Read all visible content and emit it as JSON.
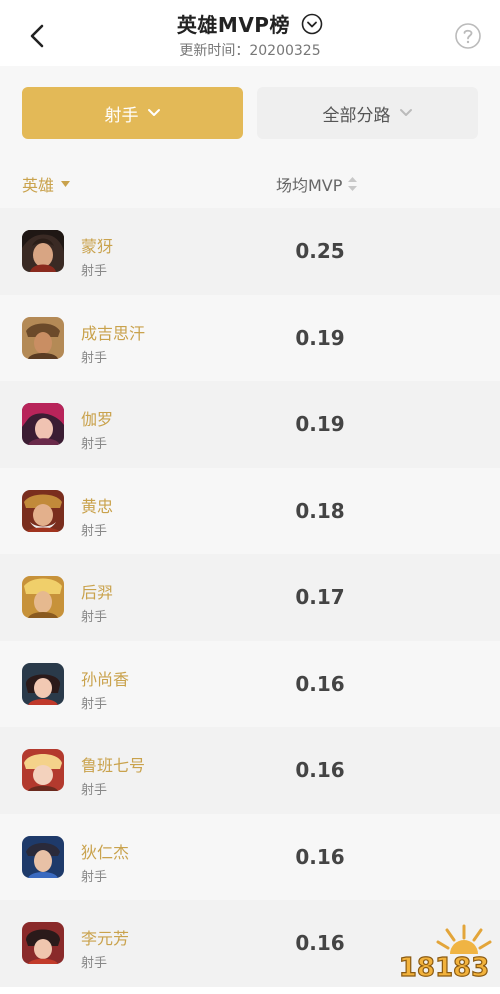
{
  "header": {
    "title": "英雄MVP榜",
    "update_label": "更新时间：20200325",
    "back_icon": "chevron-left-icon",
    "toggle_icon": "chevron-down-circle-icon",
    "help_icon": "question-circle-icon"
  },
  "filters": {
    "role_label": "射手",
    "lane_label": "全部分路"
  },
  "columns": {
    "hero": "英雄",
    "mvp": "场均MVP"
  },
  "heroes": [
    {
      "name": "蒙犽",
      "role": "射手",
      "mvp": "0.25"
    },
    {
      "name": "成吉思汗",
      "role": "射手",
      "mvp": "0.19"
    },
    {
      "name": "伽罗",
      "role": "射手",
      "mvp": "0.19"
    },
    {
      "name": "黄忠",
      "role": "射手",
      "mvp": "0.18"
    },
    {
      "name": "后羿",
      "role": "射手",
      "mvp": "0.17"
    },
    {
      "name": "孙尚香",
      "role": "射手",
      "mvp": "0.16"
    },
    {
      "name": "鲁班七号",
      "role": "射手",
      "mvp": "0.16"
    },
    {
      "name": "狄仁杰",
      "role": "射手",
      "mvp": "0.16"
    },
    {
      "name": "李元芳",
      "role": "射手",
      "mvp": "0.16"
    }
  ],
  "colors": {
    "accent": "#e3b957",
    "hero_name": "#c9a24c"
  },
  "watermark": "18183"
}
